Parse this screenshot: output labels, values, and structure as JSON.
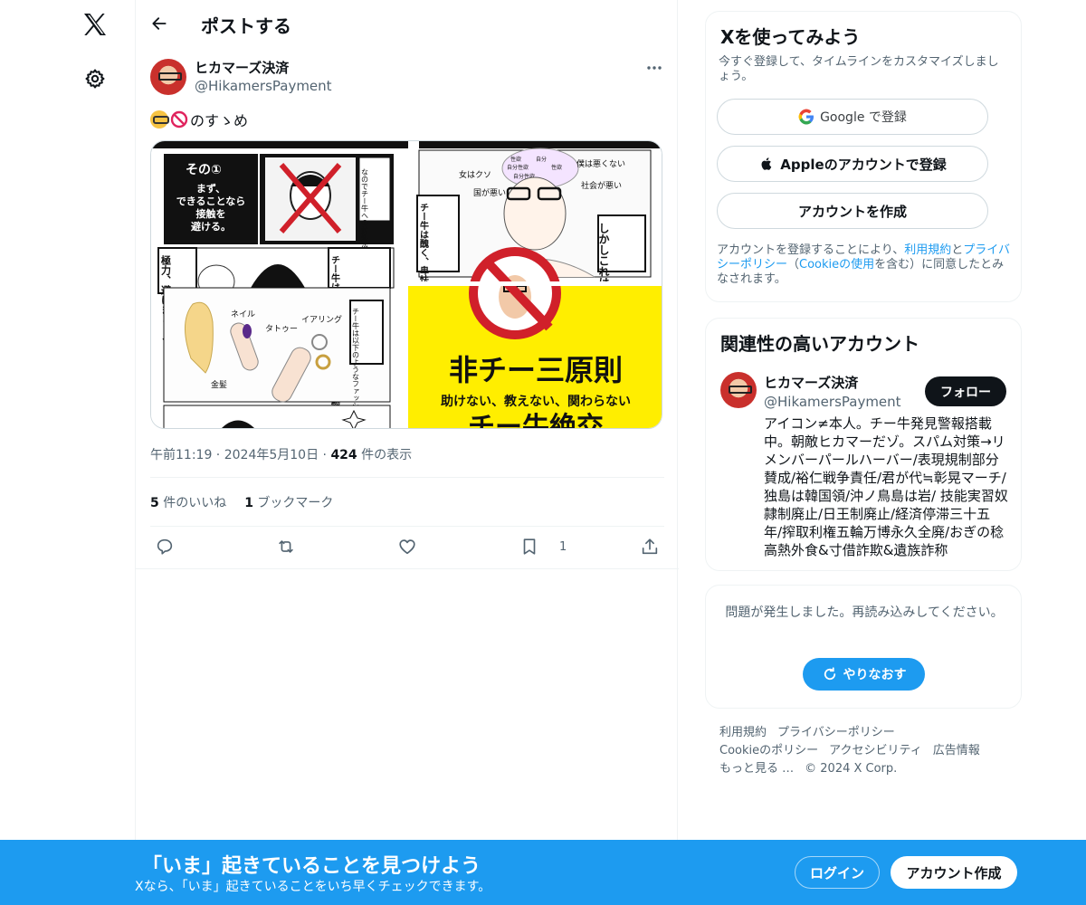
{
  "nav": {
    "logo": "x-logo-icon",
    "settings": "gear-icon"
  },
  "header": {
    "title": "ポストする",
    "back": "back-arrow-icon"
  },
  "post": {
    "author_name": "ヒカマーズ決済",
    "author_handle": "@HikamersPayment",
    "text": "のすゝめ",
    "emojis": [
      "nerd-face-emoji",
      "prohibited-emoji"
    ],
    "media": {
      "panel1": {
        "heading": "その①",
        "body": [
          "まず、",
          "できることなら",
          "接触を",
          "避ける。"
        ],
        "bubble": "なのでチー牛への対処法を教えたいと思います"
      },
      "panel2": {
        "labels": [
          "女はクソ",
          "国が悪い",
          "僕は悪くない",
          "社会が悪い",
          "性欲",
          "自分",
          "自分性欲",
          "性欲",
          "自分性欲"
        ],
        "box1": "チー牛は醜く、卑怯で自分勝手です同情は絶対ダメ",
        "box2": "しかしこれは罠です"
      },
      "panel3": {
        "labels": [
          "極力、避けましょう",
          "チー牛はたったの一言話しただけで惚れてしまう"
        ]
      },
      "panel4": {
        "labels": [
          "ネイル",
          "タトゥー",
          "イアリング",
          "金髪"
        ],
        "box": "チー牛は以下のようなファッションを嫌います"
      },
      "panel5": {
        "title": "非チー三原則",
        "subtitle": "助けない、教えない、関わらない",
        "bottom": "チー牛絶交"
      }
    },
    "meta": {
      "time": "午前11:19",
      "date": "2024年5月10日",
      "views": "424",
      "views_label": "件の表示"
    },
    "stats": {
      "likes": "5",
      "likes_label": "件のいいね",
      "bookmarks": "1",
      "bookmarks_label": "ブックマーク"
    },
    "actions": {
      "reply": "reply-icon",
      "repost": "repost-icon",
      "like": "heart-icon",
      "bookmark": "bookmark-icon",
      "bookmark_count": "1",
      "share": "share-icon"
    }
  },
  "signup_card": {
    "title": "Xを使ってみよう",
    "subtitle": "今すぐ登録して、タイムラインをカスタマイズしましょう。",
    "google": "Google で登録",
    "apple": "Appleのアカウントで登録",
    "create": "アカウントを作成",
    "terms": {
      "t1": "アカウントを登録することにより、",
      "l1": "利用規約",
      "t2": "と",
      "l2": "プライバシーポリシー",
      "t3": "（",
      "l3": "Cookieの使用",
      "t4": "を含む）に同意したとみなされます。"
    }
  },
  "related": {
    "title": "関連性の高いアカウント",
    "name": "ヒカマーズ決済",
    "handle": "@HikamersPayment",
    "follow": "フォロー",
    "bio": "アイコン≠本人。チー牛発見警報搭載中。朝敵ヒカマーだゾ。スパム対策→リメンバーパールハーバー/表現規制部分賛成/裕仁戦争責任/君が代≒彰晃マーチ/独島は韓国領/沖ノ鳥島は岩/ 技能実習奴隷制廃止/日王制廃止/経済停滞三十五年/搾取利権五輪万博永久全廃/おぎの稔高熱外食&寸借詐欺&遺族詐称"
  },
  "error_card": {
    "text": "問題が発生しました。再読み込みしてください。",
    "retry": "やりなおす"
  },
  "footer": {
    "terms": "利用規約",
    "privacy": "プライバシーポリシー",
    "cookie": "Cookieのポリシー",
    "accessibility": "アクセシビリティ",
    "ads": "広告情報",
    "more": "もっと見る …",
    "copyright": "© 2024 X Corp."
  },
  "banner": {
    "title": "「いま」起きていることを見つけよう",
    "subtitle": "Xなら、「いま」起きていることをいち早くチェックできます。",
    "login": "ログイン",
    "signup": "アカウント作成"
  },
  "colors": {
    "accent": "#1d9bf0",
    "text": "#0f1419",
    "muted": "#536471",
    "border": "#eff3f4"
  }
}
